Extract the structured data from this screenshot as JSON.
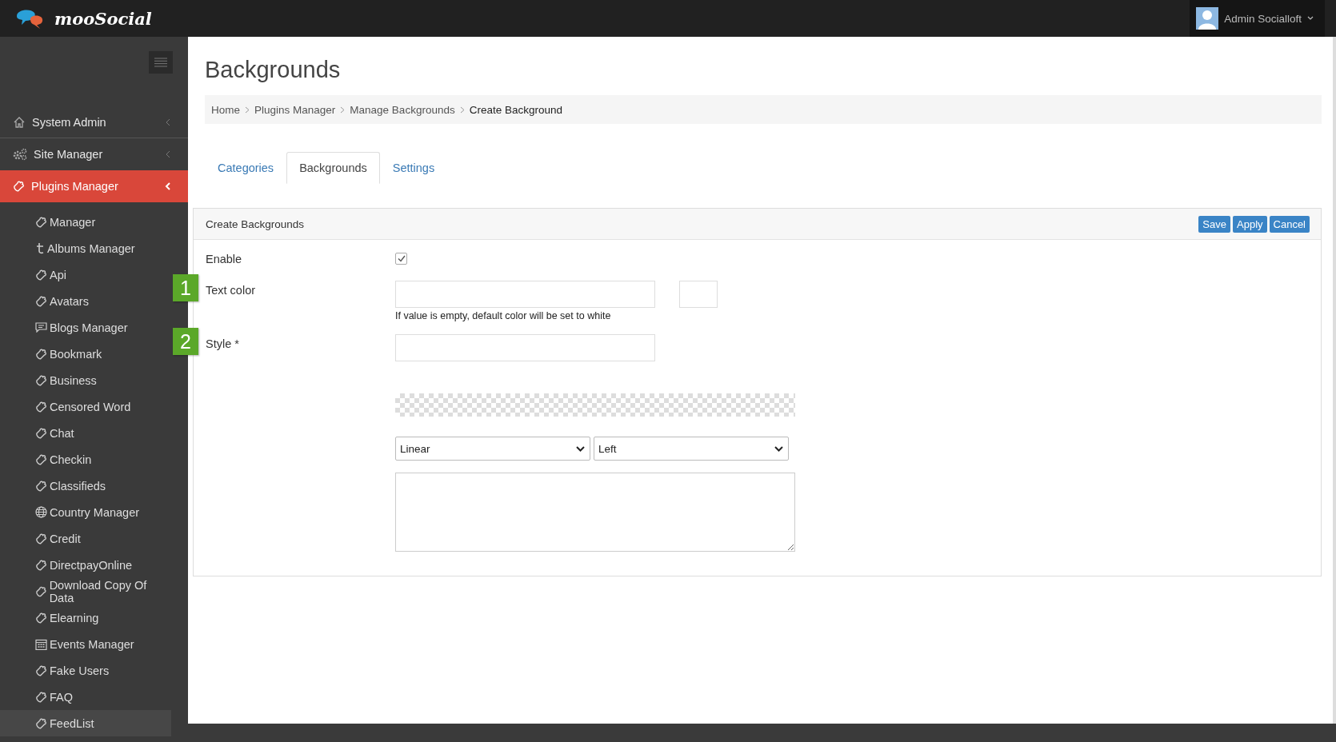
{
  "header": {
    "logo": "mooSocial",
    "user": "Admin Socialloft"
  },
  "sidebar": {
    "sections": [
      {
        "label": "System Admin",
        "kind": "home",
        "selected": false
      },
      {
        "label": "Site Manager",
        "kind": "gears",
        "selected": false
      },
      {
        "label": "Plugins Manager",
        "kind": "puzzle",
        "selected": true
      }
    ],
    "items": [
      {
        "label": "Manager",
        "kind": "puzzle",
        "selected": false
      },
      {
        "label": "Albums Manager",
        "kind": "letter",
        "selected": false
      },
      {
        "label": "Api",
        "kind": "puzzle",
        "selected": false
      },
      {
        "label": "Avatars",
        "kind": "puzzle",
        "selected": false
      },
      {
        "label": "Blogs Manager",
        "kind": "comment",
        "selected": false
      },
      {
        "label": "Bookmark",
        "kind": "puzzle",
        "selected": false
      },
      {
        "label": "Business",
        "kind": "puzzle",
        "selected": false
      },
      {
        "label": "Censored Word",
        "kind": "puzzle",
        "selected": false
      },
      {
        "label": "Chat",
        "kind": "puzzle",
        "selected": false
      },
      {
        "label": "Checkin",
        "kind": "puzzle",
        "selected": false
      },
      {
        "label": "Classifieds",
        "kind": "puzzle",
        "selected": false
      },
      {
        "label": "Country Manager",
        "kind": "globe",
        "selected": false
      },
      {
        "label": "Credit",
        "kind": "puzzle",
        "selected": false
      },
      {
        "label": "DirectpayOnline",
        "kind": "puzzle",
        "selected": false
      },
      {
        "label": "Download Copy Of Data",
        "kind": "puzzle",
        "selected": false
      },
      {
        "label": "Elearning",
        "kind": "puzzle",
        "selected": false
      },
      {
        "label": "Events Manager",
        "kind": "calendar",
        "selected": false
      },
      {
        "label": "Fake Users",
        "kind": "puzzle",
        "selected": false
      },
      {
        "label": "FAQ",
        "kind": "puzzle",
        "selected": false
      },
      {
        "label": "FeedList",
        "kind": "puzzle",
        "selected": true
      }
    ]
  },
  "page": {
    "title": "Backgrounds",
    "breadcrumb": [
      "Home",
      "Plugins Manager",
      "Manage Backgrounds",
      "Create Background"
    ],
    "tabs": [
      {
        "label": "Categories",
        "selected": false
      },
      {
        "label": "Backgrounds",
        "selected": true
      },
      {
        "label": "Settings",
        "selected": false
      }
    ]
  },
  "panel": {
    "title": "Create Backgrounds",
    "buttons": [
      "Save",
      "Apply",
      "Cancel"
    ],
    "enable": {
      "label": "Enable",
      "checked": true
    },
    "text_color": {
      "label": "Text color",
      "marker": "1",
      "help": "If value is empty, default color will be set to white"
    },
    "style": {
      "label": "Style *",
      "marker": "2"
    },
    "gradient_type": "Linear",
    "gradient_direction": "Left"
  }
}
